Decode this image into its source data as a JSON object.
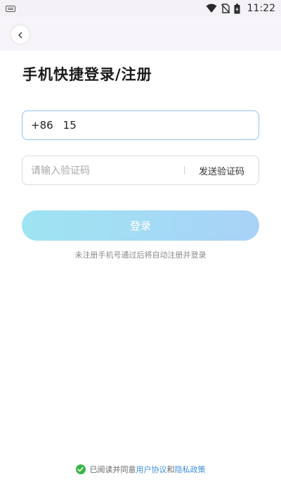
{
  "status_bar": {
    "time": "11:22",
    "icons": [
      "keyboard-icon",
      "wifi-icon",
      "no-sim-icon",
      "battery-charging-icon"
    ]
  },
  "header": {
    "back_icon": "chevron-left-icon"
  },
  "title": "手机快捷登录/注册",
  "phone": {
    "country_code": "+86",
    "value": "15"
  },
  "verification": {
    "placeholder": "请输入验证码",
    "send_label": "发送验证码"
  },
  "login_label": "登录",
  "hint": "未注册手机号通过后将自动注册并登录",
  "agreement": {
    "prefix": "已阅读并同意",
    "user_agreement": "用户协议",
    "connector": "和",
    "privacy_policy": "隐私政策"
  },
  "colors": {
    "accent_link": "#3d8fe0",
    "check_green": "#3bb54a",
    "button_gradient_start": "#9ee4f2",
    "button_gradient_end": "#a9d2f7",
    "focused_border": "#8cc3ee"
  }
}
